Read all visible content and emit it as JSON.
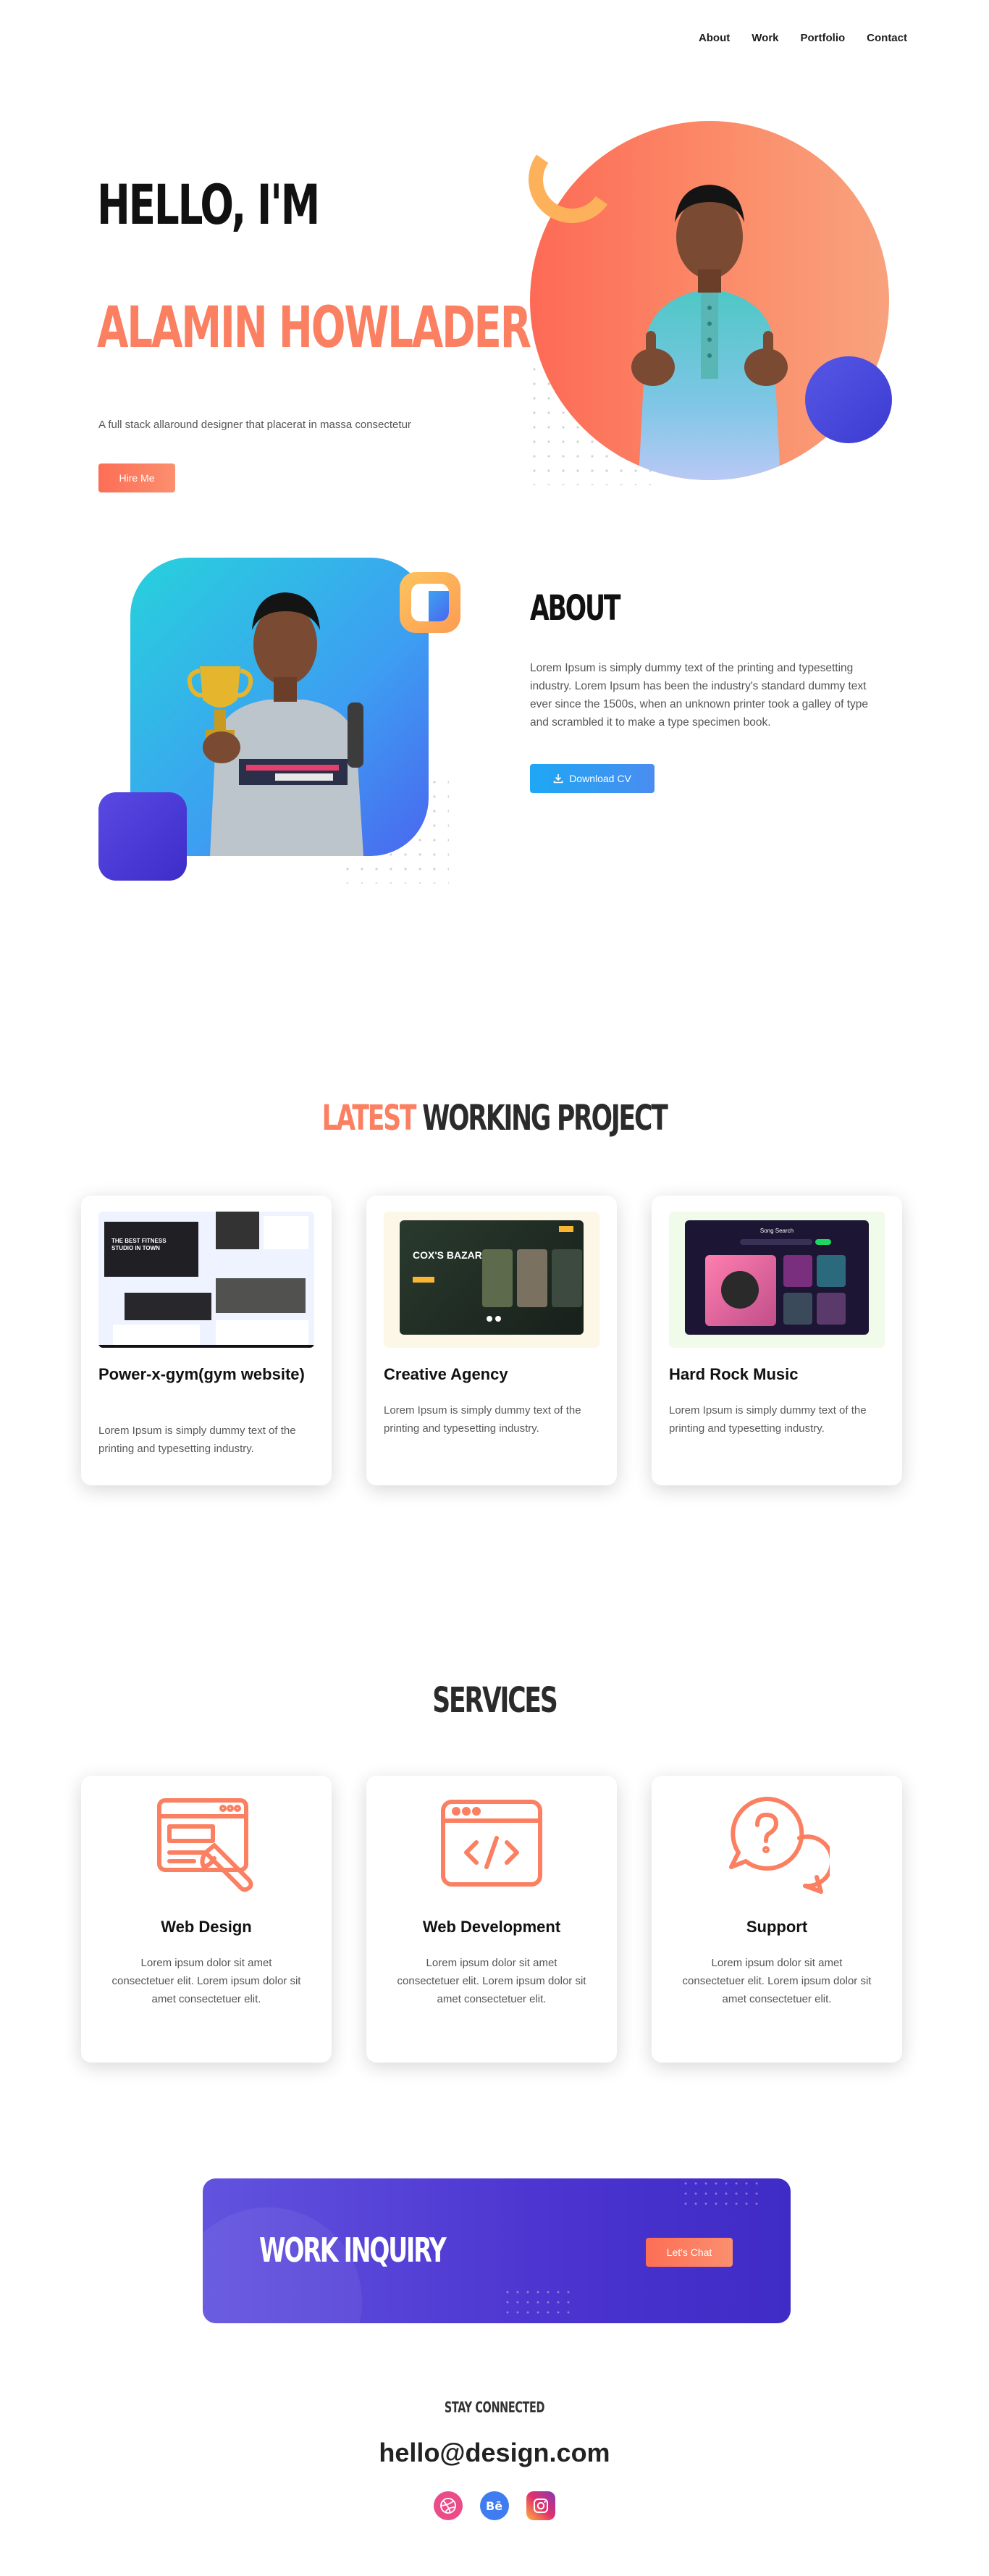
{
  "nav": {
    "items": [
      {
        "label": "About"
      },
      {
        "label": "Work"
      },
      {
        "label": "Portfolio"
      },
      {
        "label": "Contact"
      }
    ]
  },
  "hero": {
    "greeting": "HELLO, I'M",
    "name": "ALAMIN HOWLADER",
    "tagline": "A full stack allaround designer that placerat in massa consectetur",
    "cta_label": "Hire Me"
  },
  "about": {
    "title": "ABOUT",
    "text": "Lorem Ipsum is simply dummy text of the printing and typesetting industry. Lorem Ipsum has been the industry's standard dummy text ever since the 1500s, when an unknown printer took a galley of type and scrambled it to make a type specimen book.",
    "cta_label": "Download CV"
  },
  "projects": {
    "title_highlight": "LATEST",
    "title_rest": "WORKING PROJECT",
    "items": [
      {
        "title": "Power-x-gym(gym website)",
        "text": "Lorem Ipsum is simply dummy text of the printing and typesetting industry.",
        "thumb_heading": "THE BEST FITNESS STUDIO IN TOWN"
      },
      {
        "title": "Creative Agency",
        "text": "Lorem Ipsum is simply dummy text of the printing and typesetting industry.",
        "thumb_heading": "COX'S BAZAR"
      },
      {
        "title": "Hard Rock Music",
        "text": "Lorem Ipsum is simply dummy text of the printing and typesetting industry.",
        "thumb_heading": "Song Search"
      }
    ]
  },
  "services": {
    "title": "SERVICES",
    "items": [
      {
        "title": "Web Design",
        "text": "Lorem ipsum dolor sit amet consectetuer elit. Lorem ipsum dolor sit amet consectetuer elit.",
        "icon": "web-design-icon"
      },
      {
        "title": "Web Development",
        "text": "Lorem ipsum dolor sit amet consectetuer elit. Lorem ipsum dolor sit amet consectetuer elit.",
        "icon": "code-window-icon"
      },
      {
        "title": "Support",
        "text": "Lorem ipsum dolor sit amet consectetuer elit. Lorem ipsum dolor sit amet consectetuer elit.",
        "icon": "question-chat-icon"
      }
    ]
  },
  "inquiry": {
    "title": "WORK INQUIRY",
    "cta_label": "Let's Chat"
  },
  "footer": {
    "stay_connected": "STAY CONNECTED",
    "email": "hello@design.com",
    "socials": [
      {
        "name": "dribbble-icon",
        "color": "#ea4c89"
      },
      {
        "name": "behance-icon",
        "color": "#3f7cf0"
      },
      {
        "name": "instagram-icon",
        "color": "#c13584"
      }
    ]
  },
  "colors": {
    "accent_orange": "#fb7f61",
    "accent_blue": "#1ea7f4",
    "accent_purple": "#4b34cf"
  }
}
